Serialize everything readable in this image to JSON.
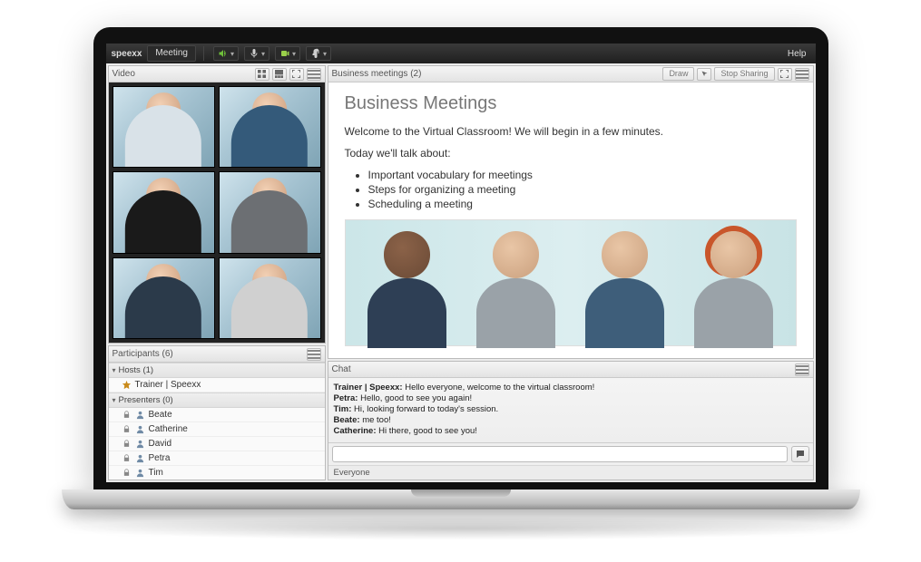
{
  "topbar": {
    "brand": "speexx",
    "menu": "Meeting",
    "help": "Help"
  },
  "video": {
    "title": "Video"
  },
  "participants": {
    "title": "Participants  (6)",
    "hosts_label": "Hosts (1)",
    "presenters_label": "Presenters (0)",
    "host_name": "Trainer | Speexx",
    "list": [
      "Beate",
      "Catherine",
      "David",
      "Petra",
      "Tim"
    ]
  },
  "content": {
    "title": "Business meetings (2)",
    "btn_draw": "Draw",
    "btn_stop": "Stop Sharing",
    "heading": "Business Meetings",
    "welcome": "Welcome to the Virtual Classroom! We will begin in a few minutes.",
    "talk_about": "Today we'll talk about:",
    "bullets": [
      "Important vocabulary for meetings",
      "Steps for organizing a meeting",
      "Scheduling a meeting"
    ]
  },
  "chat": {
    "title": "Chat",
    "messages": [
      {
        "from": "Trainer | Speexx",
        "text": "Hello everyone, welcome to the virtual classroom!"
      },
      {
        "from": "Petra",
        "text": "Hello, good to see you again!"
      },
      {
        "from": "Tim",
        "text": "Hi, looking forward to today's session."
      },
      {
        "from": "Beate",
        "text": "me too!"
      },
      {
        "from": "Catherine",
        "text": "Hi there, good to see you!"
      }
    ],
    "to": "Everyone"
  }
}
